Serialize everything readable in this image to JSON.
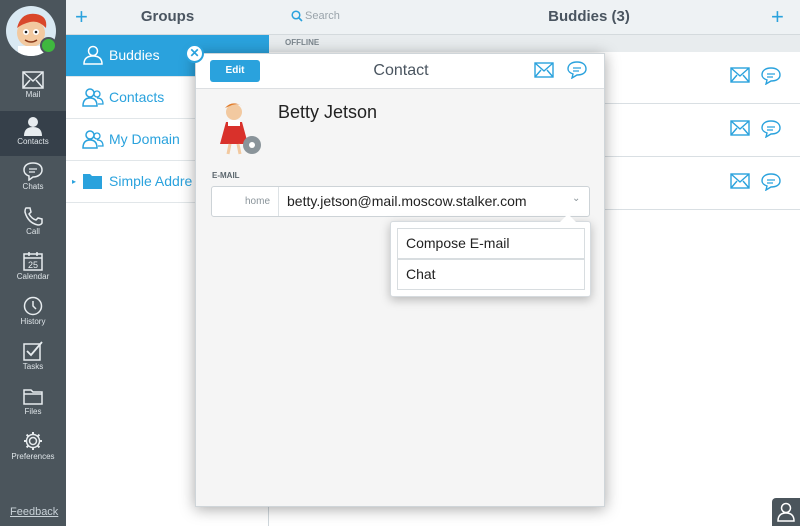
{
  "rail": {
    "items": [
      {
        "label": "Mail",
        "icon": "mail-icon"
      },
      {
        "label": "Contacts",
        "icon": "contacts-icon",
        "active": true
      },
      {
        "label": "Chats",
        "icon": "chat-icon"
      },
      {
        "label": "Call",
        "icon": "phone-icon"
      },
      {
        "label": "Calendar",
        "icon": "calendar-icon",
        "badge": "25"
      },
      {
        "label": "History",
        "icon": "clock-icon"
      },
      {
        "label": "Tasks",
        "icon": "checkbox-icon"
      },
      {
        "label": "Files",
        "icon": "folder-icon"
      },
      {
        "label": "Preferences",
        "icon": "gear-icon"
      }
    ],
    "feedback": "Feedback"
  },
  "groups": {
    "title": "Groups",
    "add": "+",
    "items": [
      {
        "label": "Buddies",
        "selected": true
      },
      {
        "label": "Contacts"
      },
      {
        "label": "My Domain"
      },
      {
        "label": "Simple Addre"
      }
    ]
  },
  "buddies": {
    "title": "Buddies (3)",
    "add": "+",
    "search_placeholder": "Search",
    "section": "OFFLINE"
  },
  "contact": {
    "edit_label": "Edit",
    "title": "Contact",
    "close": "✕",
    "name": "Betty Jetson",
    "email_section": "E-MAIL",
    "email_type": "home",
    "email_value": "betty.jetson@mail.moscow.stalker.com",
    "chevron": "⌄"
  },
  "menu": {
    "items": [
      "Compose E-mail",
      "Chat"
    ]
  },
  "colors": {
    "accent": "#2aa2dd",
    "rail": "#4b555c",
    "presence": "#3fb83f"
  }
}
